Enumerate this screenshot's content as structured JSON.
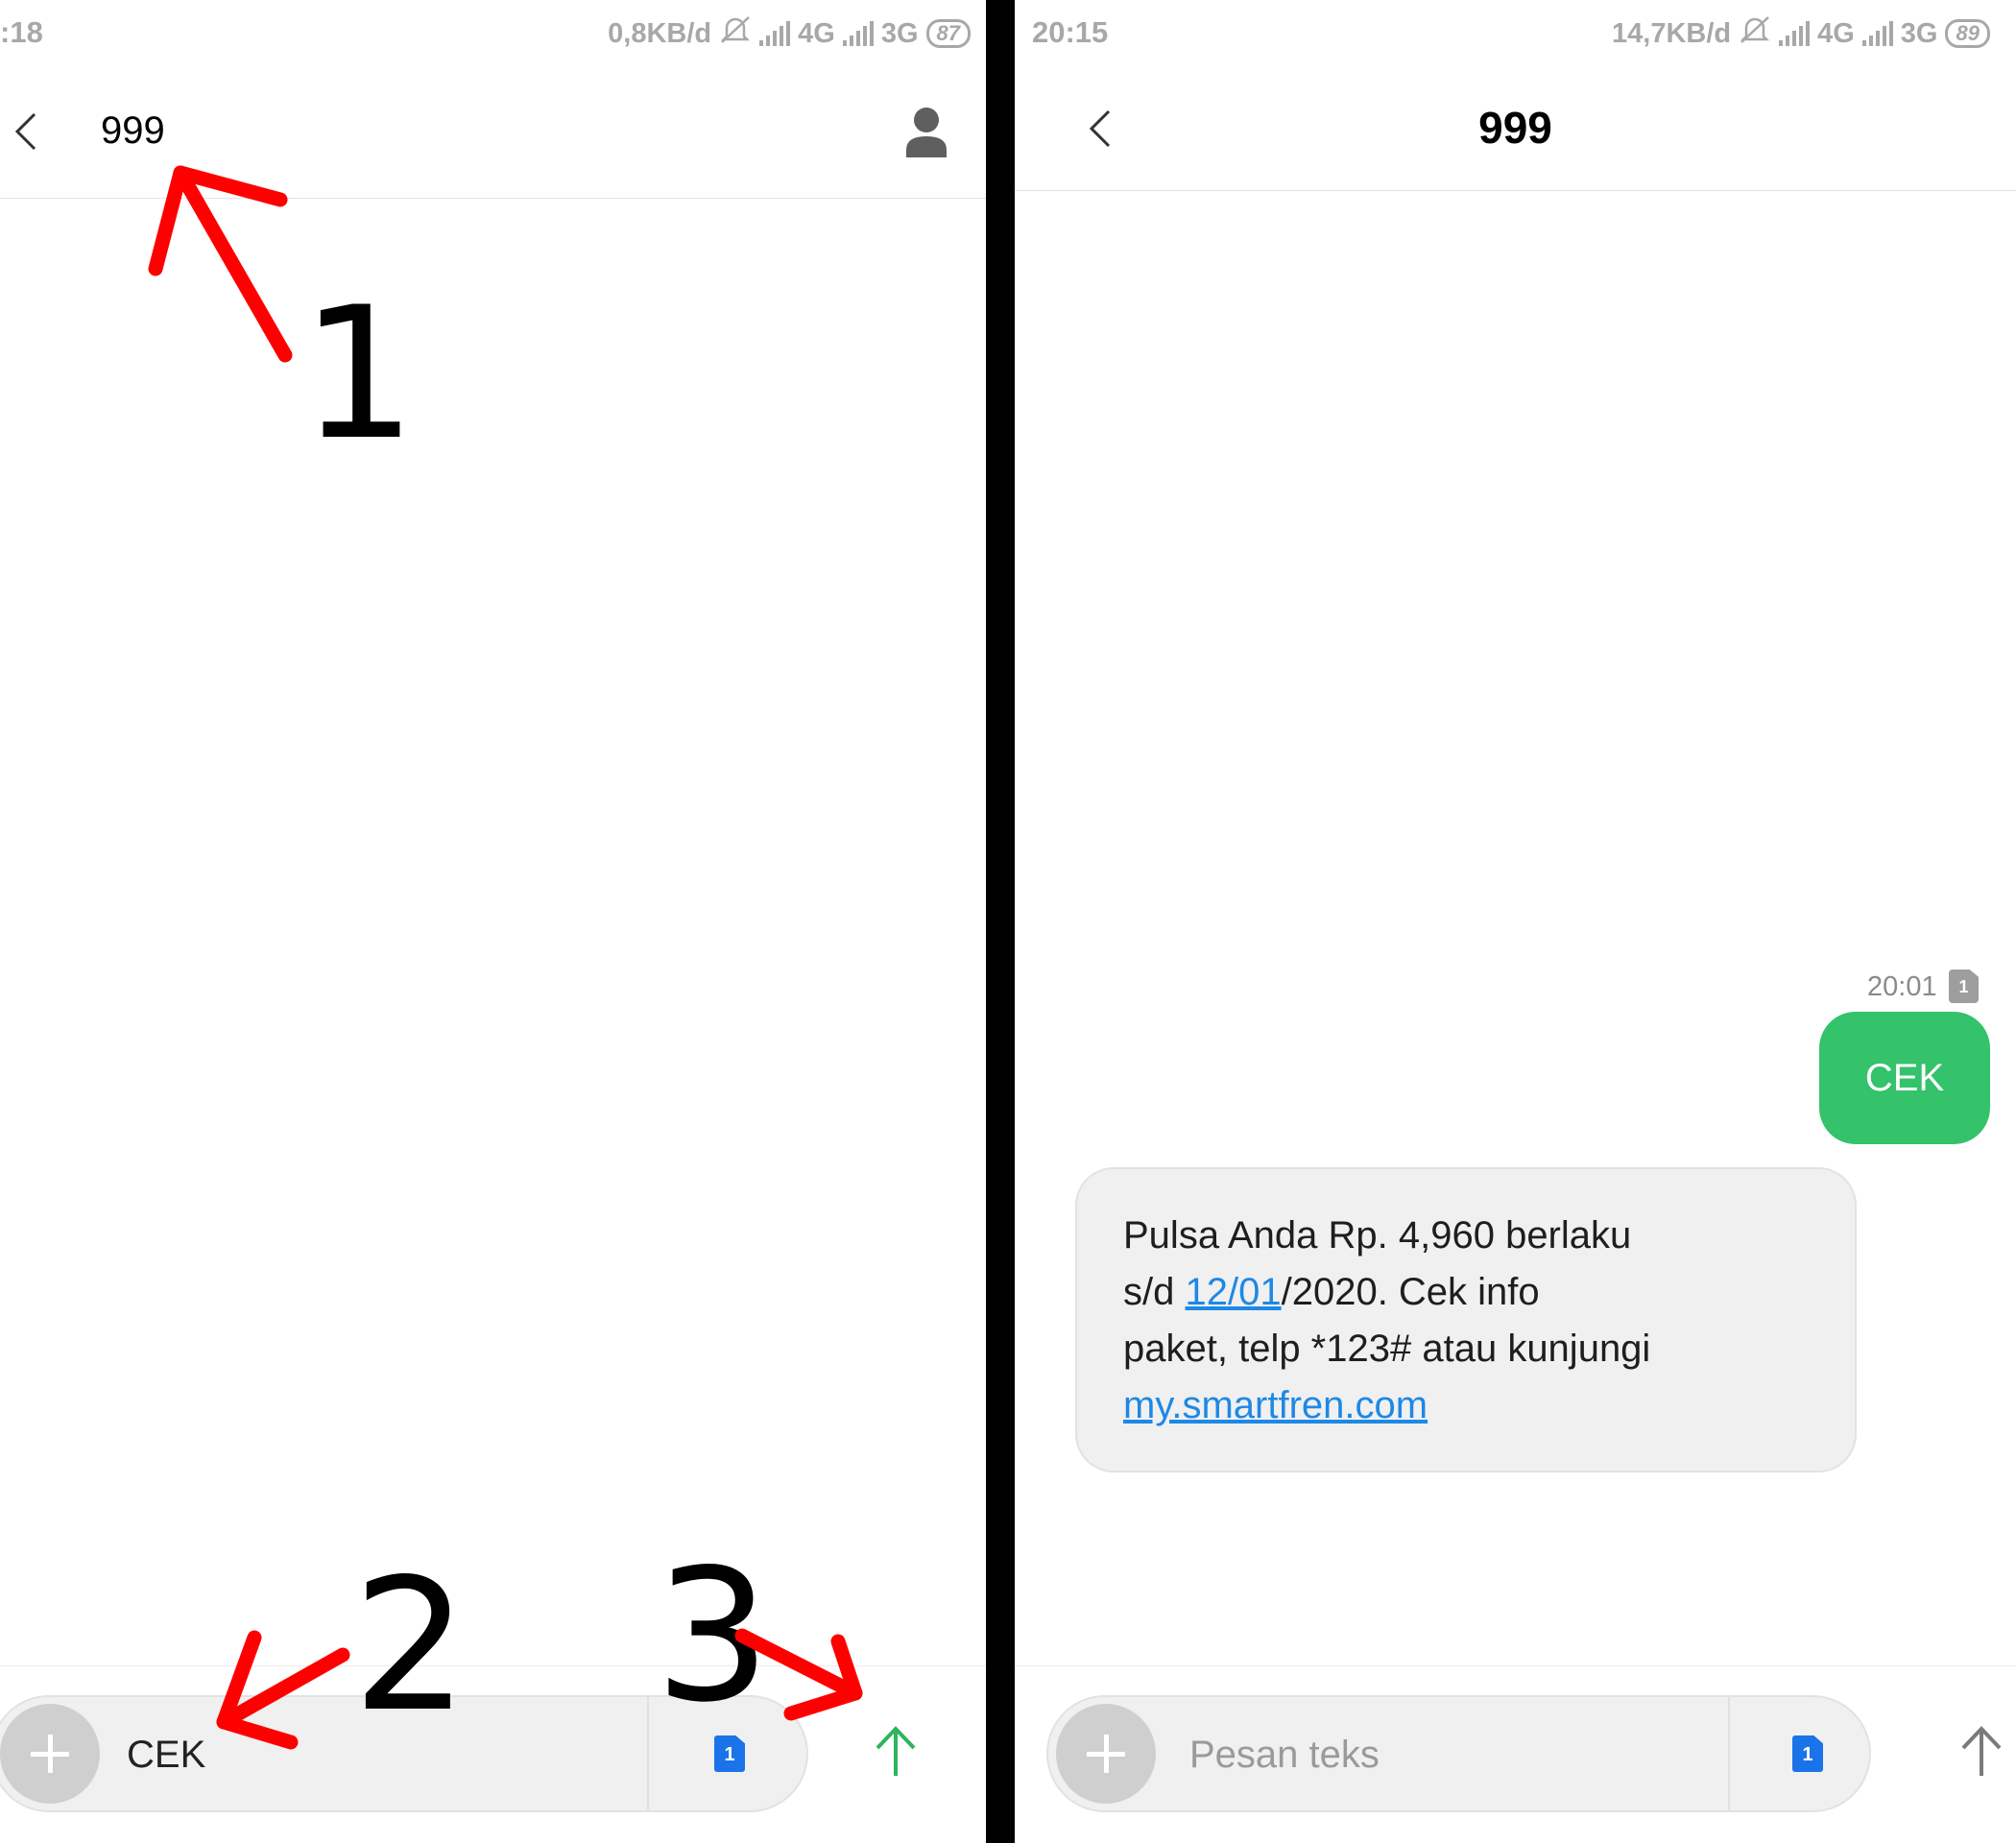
{
  "left_screen": {
    "status": {
      "time": ":18",
      "speed": "0,8KB/d",
      "net1": "4G",
      "net2": "3G",
      "battery": "87"
    },
    "header": {
      "contact": "999"
    },
    "composer": {
      "input_value": "CEK",
      "sim_label": "1"
    }
  },
  "right_screen": {
    "status": {
      "time": "20:15",
      "speed": "14,7KB/d",
      "net1": "4G",
      "net2": "3G",
      "battery": "89"
    },
    "header": {
      "contact": "999"
    },
    "messages": {
      "sent": {
        "time": "20:01",
        "sim_label": "1",
        "text": "CEK"
      },
      "received": {
        "line1": "Pulsa Anda Rp. 4,960 berlaku",
        "line2_prefix": "s/d ",
        "line2_link": "12/01",
        "line2_suffix": "/2020. Cek info",
        "line3": "paket, telp *123# atau kunjungi",
        "line4_link": "my.smartfren.com"
      }
    },
    "composer": {
      "placeholder": "Pesan teks",
      "sim_label": "1"
    }
  },
  "annotations": {
    "step1": "1",
    "step2": "2",
    "step3": "3"
  },
  "colors": {
    "arrow": "#ff0000",
    "sent_bubble": "#34c26b",
    "send_active": "#2bb55e",
    "link": "#1e88e5"
  }
}
